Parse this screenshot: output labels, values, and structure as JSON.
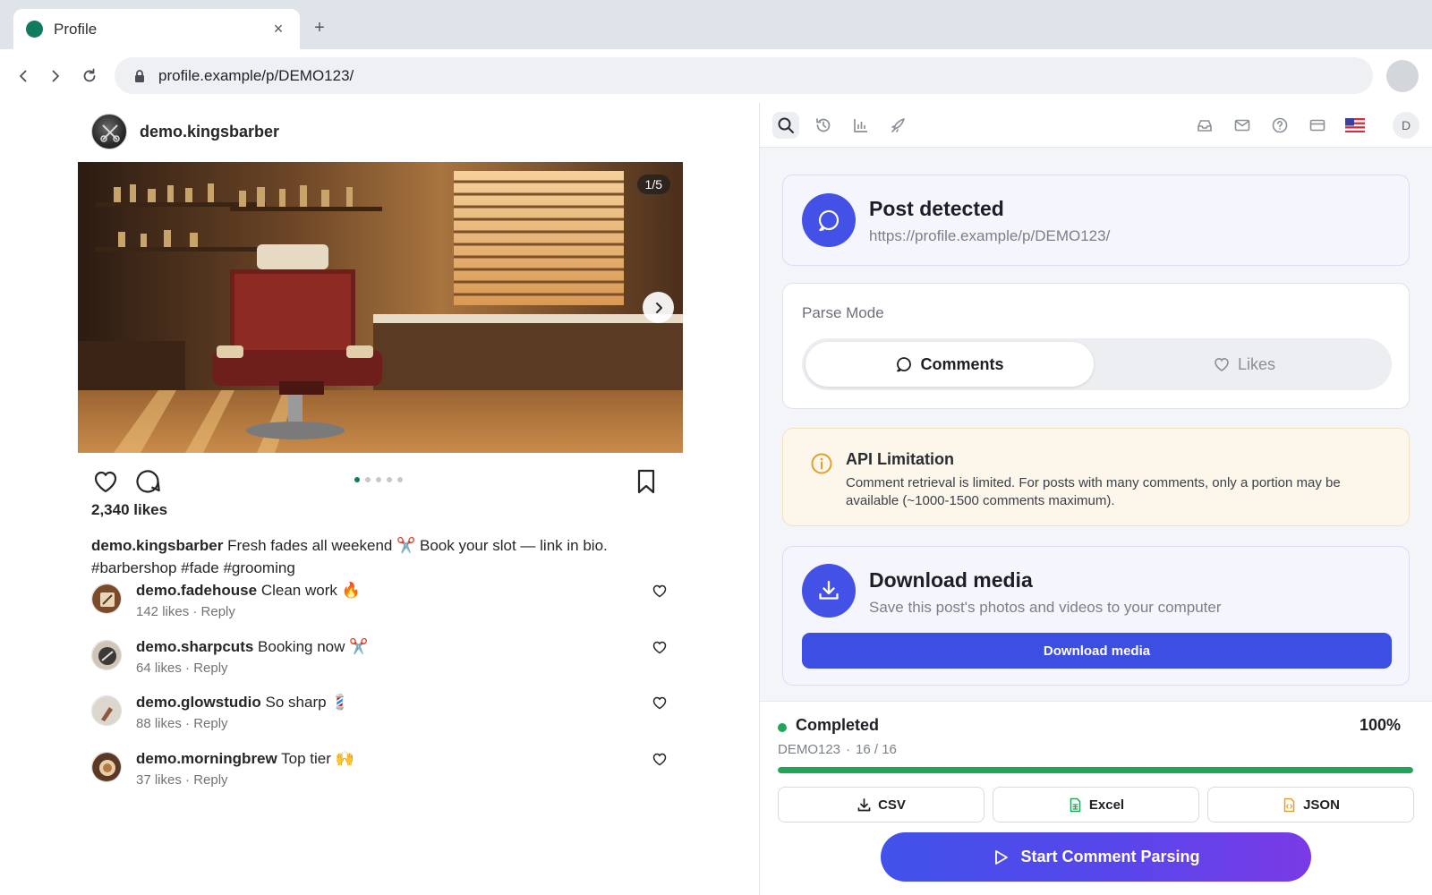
{
  "browser": {
    "tab_title": "Profile",
    "tab_close": "×",
    "new_tab": "+",
    "url": "profile.example/p/DEMO123/"
  },
  "post": {
    "username": "demo.kingsbarber",
    "media_counter": "1/5",
    "media_index": 1,
    "media_total": 5,
    "likes": "2,340 likes",
    "caption_user": "demo.kingsbarber",
    "caption_text": "Fresh fades all weekend ✂️ Book your slot — link in bio.",
    "caption_tags": "#barbershop #fade #grooming",
    "comments": [
      {
        "user": "demo.fadehouse",
        "text": "Clean work 🔥",
        "meta": "142 likes · Reply"
      },
      {
        "user": "demo.sharpcuts",
        "text": "Booking now ✂️",
        "meta": "64 likes · Reply"
      },
      {
        "user": "demo.glowstudio",
        "text": "So sharp 💈",
        "meta": "88 likes · Reply"
      },
      {
        "user": "demo.morningbrew",
        "text": "Top tier 🙌",
        "meta": "37 likes · Reply"
      }
    ]
  },
  "extension": {
    "toolbar_icons": [
      "search-icon",
      "history-icon",
      "chart-icon",
      "rocket-icon",
      "inbox-icon",
      "mail-icon",
      "help-icon",
      "card-icon",
      "us-flag-icon"
    ],
    "user_initial": "D",
    "detect": {
      "title": "Post detected",
      "url": "https://profile.example/p/DEMO123/"
    },
    "parse_mode": {
      "label": "Parse Mode",
      "options": [
        "Comments",
        "Likes"
      ],
      "selected": "Comments"
    },
    "warning": {
      "title": "API Limitation",
      "text": "Comment retrieval is limited. For posts with many comments, only a portion may be available (~1000-1500 comments maximum)."
    },
    "download": {
      "title": "Download media",
      "subtitle": "Save this post's photos and videos to your computer",
      "button": "Download media"
    },
    "status": {
      "label": "Completed",
      "percent": "100%",
      "progress": 1.0,
      "post_id": "DEMO123",
      "separator": "·",
      "count": "16 / 16"
    },
    "exports": [
      "CSV",
      "Excel",
      "JSON"
    ],
    "start_button": "Start Comment Parsing"
  },
  "colors": {
    "accent": "#4451e6",
    "success": "#22a55a",
    "brand_dot": "#127a5e",
    "warning_bg": "#fdf6ea",
    "warning_icon": "#e2a02a"
  }
}
